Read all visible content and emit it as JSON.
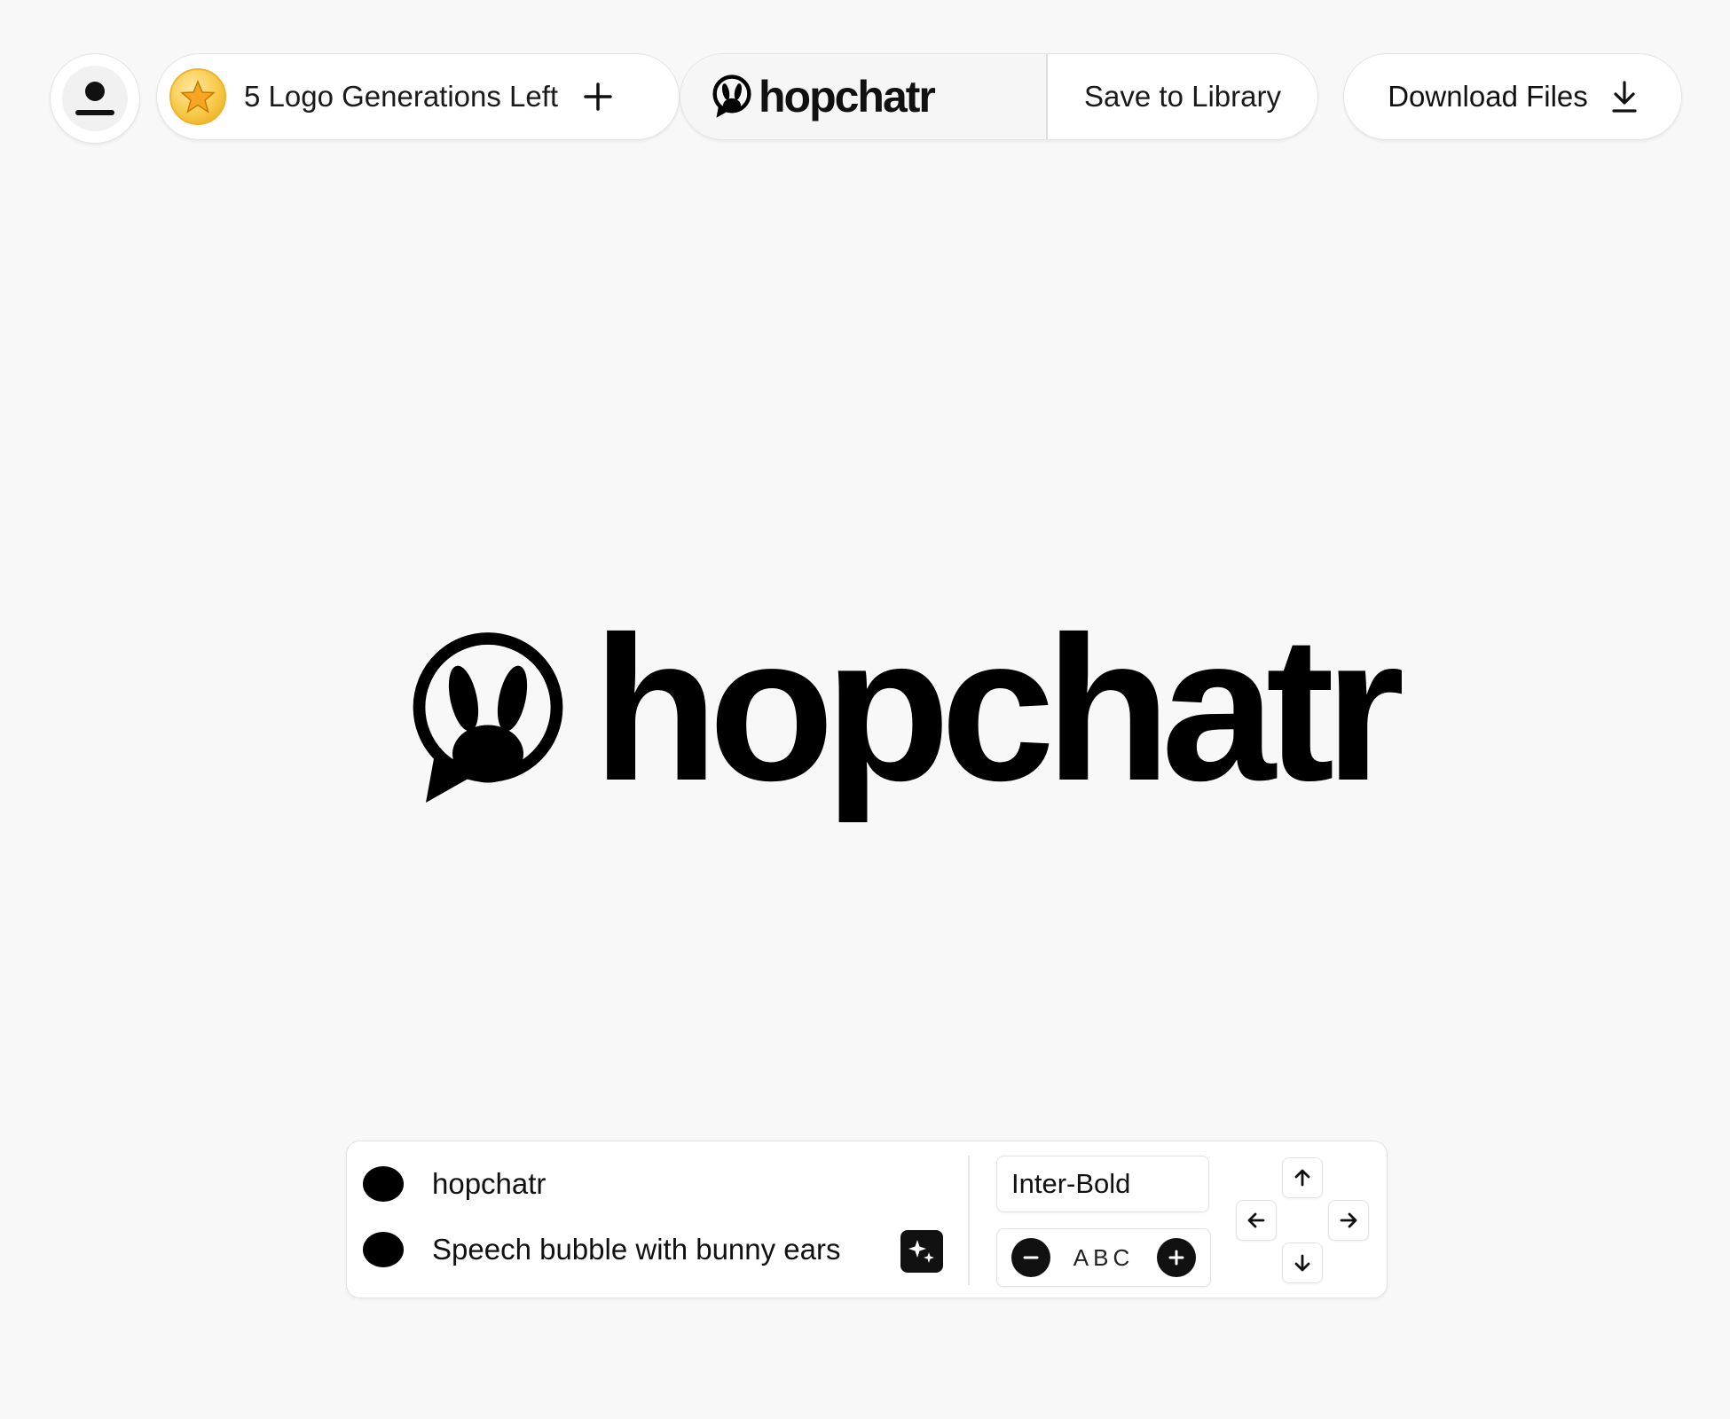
{
  "header": {
    "generations_label": "5 Logo Generations Left",
    "brand_name": "hopchatr",
    "save_label": "Save to Library",
    "download_label": "Download Files"
  },
  "canvas": {
    "wordmark": "hopchatr"
  },
  "editor": {
    "text_value": "hopchatr",
    "icon_prompt": "Speech bubble with bunny ears",
    "font_name": "Inter-Bold",
    "spacing_sample": "ABC"
  },
  "colors": {
    "background": "#f8f8f8",
    "ink": "#000000",
    "coin": "#f7c948"
  },
  "icons": {
    "avatar": "user-icon",
    "coin": "star-coin-icon",
    "add": "plus-icon",
    "download": "download-icon",
    "magic": "sparkle-icon",
    "decrease": "minus-icon",
    "increase": "plus-icon",
    "nudge": [
      "arrow-up-icon",
      "arrow-left-icon",
      "arrow-right-icon",
      "arrow-down-icon"
    ]
  }
}
